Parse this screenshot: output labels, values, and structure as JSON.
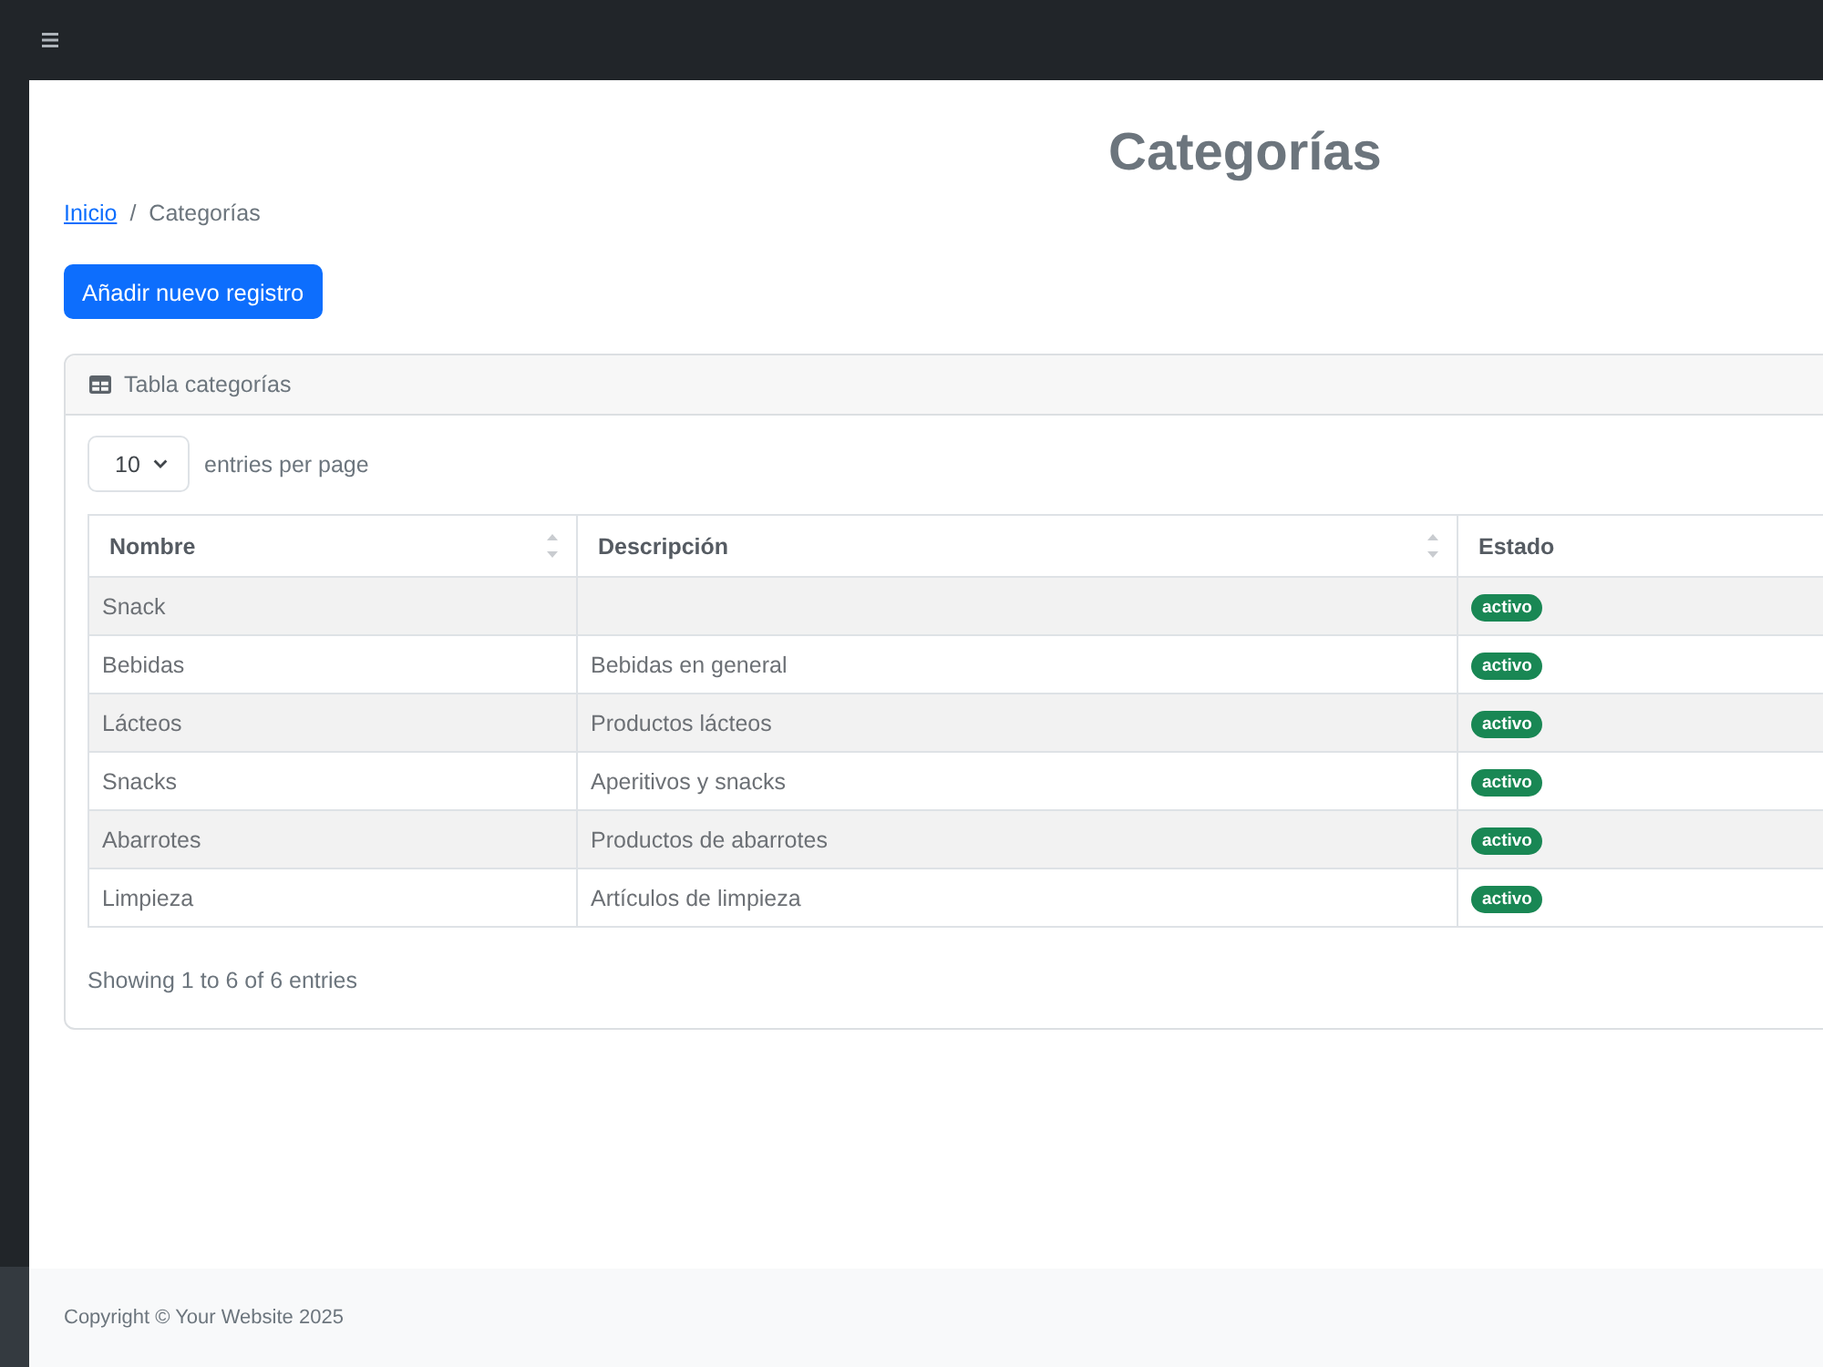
{
  "page": {
    "title": "Categorías"
  },
  "breadcrumb": {
    "separator": "/",
    "items": [
      {
        "label": "Inicio",
        "link": true
      },
      {
        "label": "Categorías",
        "link": false
      }
    ]
  },
  "add_button": "Añadir nuevo registro",
  "card": {
    "title": "Tabla categorías",
    "page_size": "10",
    "page_size_label": "entries per page",
    "columns": [
      {
        "label": "Nombre",
        "sortable": true
      },
      {
        "label": "Descripción",
        "sortable": true
      },
      {
        "label": "Estado"
      }
    ],
    "rows": [
      {
        "nombre": "Snack",
        "estado": "activo"
      },
      {
        "nombre": "Bebidas",
        "descripcion": "Bebidas en general",
        "estado": "activo"
      },
      {
        "nombre": "Lácteos",
        "descripcion": "Productos lácteos",
        "estado": "activo"
      },
      {
        "nombre": "Snacks",
        "descripcion": "Aperitivos y snacks",
        "estado": "activo"
      },
      {
        "nombre": "Abarrotes",
        "descripcion": "Productos de abarrotes",
        "estado": "activo"
      },
      {
        "nombre": "Limpieza",
        "descripcion": "Artículos de limpieza",
        "estado": "activo"
      }
    ],
    "info": "Showing 1 to 6 of 6 entries"
  },
  "footer": {
    "text": "Copyright © Your Website 2025"
  }
}
